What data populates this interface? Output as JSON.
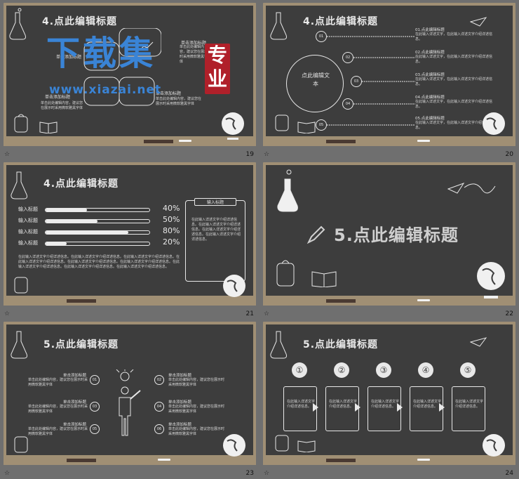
{
  "slides": {
    "s19": {
      "title": "4.点此编辑标题",
      "page": "19",
      "label_a": "单击添加标题",
      "label_b": "单击添加标题",
      "label_c": "单击添加标题",
      "label_d": "单击添加标题",
      "label_e": "单击添加标题",
      "text_a": "单击此处编辑内容，建议您在展示时采用微软雅黑字体",
      "text_b": "单击此处编辑内容，建议您在展示时采用微软雅黑字体",
      "text_c": "单击此处编辑内容，建议您在展示时采用微软雅黑字体"
    },
    "s20": {
      "title": "4.点此编辑标题",
      "page": "20",
      "center_text": "点此编辑文本",
      "nodes": [
        "01",
        "02",
        "03",
        "04",
        "05"
      ],
      "items": [
        {
          "head": "01.点此编辑标题",
          "body": "在此输入详述文字，在此输入详述文字介绍详述信息。"
        },
        {
          "head": "02.点此编辑标题",
          "body": "在此输入详述文字，在此输入详述文字介绍详述信息。"
        },
        {
          "head": "03.点此编辑标题",
          "body": "在此输入详述文字，在此输入详述文字介绍详述信息。"
        },
        {
          "head": "04.点此编辑标题",
          "body": "在此输入详述文字，在此输入详述文字介绍详述信息。"
        },
        {
          "head": "05.点此编辑标题",
          "body": "在此输入详述文字，在此输入详述文字介绍详述信息。"
        }
      ]
    },
    "s21": {
      "title": "4.点此编辑标题",
      "page": "21",
      "bars": [
        {
          "label": "输入标题",
          "pct": "40%",
          "fill": 0.4
        },
        {
          "label": "输入标题",
          "pct": "50%",
          "fill": 0.5
        },
        {
          "label": "输入标题",
          "pct": "80%",
          "fill": 0.8
        },
        {
          "label": "输入标题",
          "pct": "20%",
          "fill": 0.2
        }
      ],
      "paragraph": "在此输入详述文字介绍详述信息。在此输入详述文字介绍详述信息。在此输入详述文字介绍详述信息。在此输入详述文字介绍详述信息。在此输入详述文字介绍详述信息。在此输入详述文字介绍详述信息。在此输入详述文字介绍详述信息。在此输入详述文字介绍详述信息。在此输入详述文字介绍详述信息。",
      "card_title": "输入标题",
      "card_text": "在此输入详述文字介绍详述信息。在此输入详述文字介绍详述信息。在此输入详述文字介绍详述信息。在此输入详述文字介绍详述信息。"
    },
    "s22": {
      "title": "5.点此编辑标题",
      "page": "22"
    },
    "s23": {
      "title": "5.点此编辑标题",
      "page": "23",
      "left": [
        {
          "num": "01",
          "head": "单击添加标题",
          "body": "单击此处编辑内容，建议您在展示时采用微软雅黑字体"
        },
        {
          "num": "03",
          "head": "单击添加标题",
          "body": "单击此处编辑内容，建议您在展示时采用微软雅黑字体"
        },
        {
          "num": "05",
          "head": "单击添加标题",
          "body": "单击此处编辑内容，建议您在展示时采用微软雅黑字体"
        }
      ],
      "right": [
        {
          "num": "02",
          "head": "单击添加标题",
          "body": "单击此处编辑内容，建议您在展示时采用微软雅黑字体"
        },
        {
          "num": "04",
          "head": "单击添加标题",
          "body": "单击此处编辑内容，建议您在展示时采用微软雅黑字体"
        },
        {
          "num": "06",
          "head": "单击添加标题",
          "body": "单击此处编辑内容，建议您在展示时采用微软雅黑字体"
        }
      ]
    },
    "s24": {
      "title": "5.点此编辑标题",
      "page": "24",
      "steps": [
        {
          "num": "①",
          "body": "在此输入详述文字介绍详述信息。"
        },
        {
          "num": "②",
          "body": "在此输入详述文字介绍详述信息。"
        },
        {
          "num": "③",
          "body": "在此输入详述文字介绍详述信息。"
        },
        {
          "num": "④",
          "body": "在此输入详述文字介绍详述信息。"
        },
        {
          "num": "⑤",
          "body": "在此输入详述文字介绍详述信息。"
        }
      ]
    }
  },
  "watermark": {
    "main": "下载集",
    "url": "www.xiazai.net",
    "seal_top": "专",
    "seal_bottom": "业"
  },
  "footer": {
    "star": "☆"
  },
  "colors": {
    "board": "#3d3d3d",
    "frame": "#a08f74",
    "chalk": "#e8e8e8",
    "watermark_blue": "#3a84d6",
    "seal_red": "#b0202a"
  }
}
